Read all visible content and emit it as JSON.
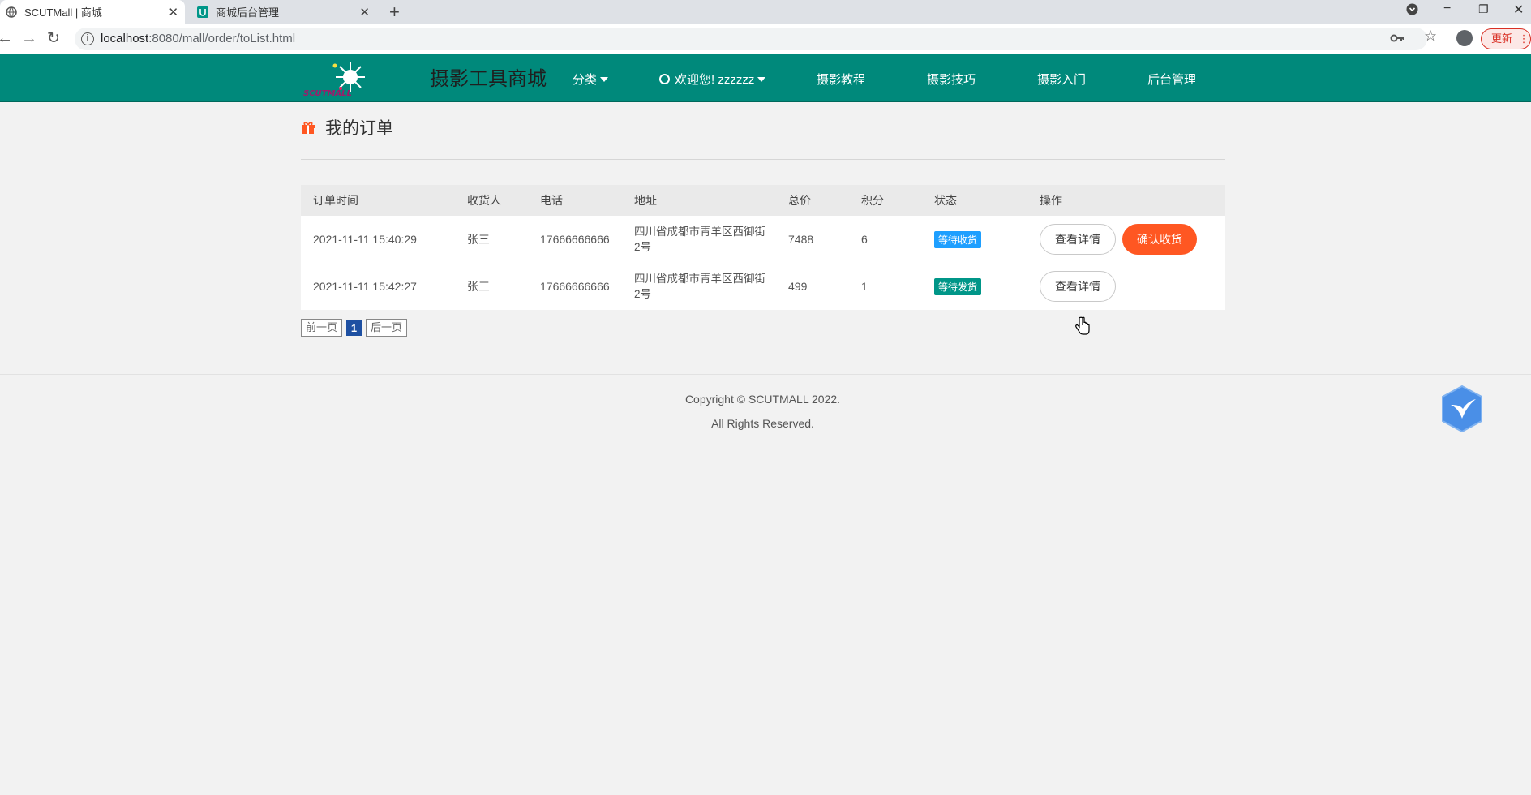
{
  "browser": {
    "tabs": [
      {
        "title": "SCUTMall | 商城",
        "active": true
      },
      {
        "title": "商城后台管理",
        "active": false
      }
    ],
    "url_host": "localhost",
    "url_rest": ":8080/mall/order/toList.html",
    "update_label": "更新"
  },
  "header": {
    "logo_text": "SCUTMALL",
    "site_title": "摄影工具商城",
    "nav": {
      "category": "分类",
      "user": "欢迎您! zzzzzz",
      "tutorials": "摄影教程",
      "tips": "摄影技巧",
      "intro": "摄影入门",
      "admin": "后台管理"
    }
  },
  "page": {
    "title": "我的订单"
  },
  "table": {
    "headers": [
      "订单时间",
      "收货人",
      "电话",
      "地址",
      "总价",
      "积分",
      "状态",
      "操作"
    ],
    "rows": [
      {
        "time": "2021-11-11 15:40:29",
        "receiver": "张三",
        "phone": "17666666666",
        "address": "四川省成都市青羊区西御街2号",
        "total": "7488",
        "points": "6",
        "status": "等待收货",
        "status_color": "#1e9fff",
        "detail_label": "查看详情",
        "confirm_label": "确认收货"
      },
      {
        "time": "2021-11-11 15:42:27",
        "receiver": "张三",
        "phone": "17666666666",
        "address": "四川省成都市青羊区西御街2号",
        "total": "499",
        "points": "1",
        "status": "等待发货",
        "status_color": "#009688",
        "detail_label": "查看详情"
      }
    ]
  },
  "pager": {
    "prev": "前一页",
    "current": "1",
    "next": "后一页"
  },
  "footer": {
    "line1": "Copyright © SCUTMALL 2022.",
    "line2": "All Rights Reserved."
  },
  "colors": {
    "header_bg": "#00897b",
    "accent_orange": "#ff5722",
    "page_num_bg": "#1e50a2"
  }
}
